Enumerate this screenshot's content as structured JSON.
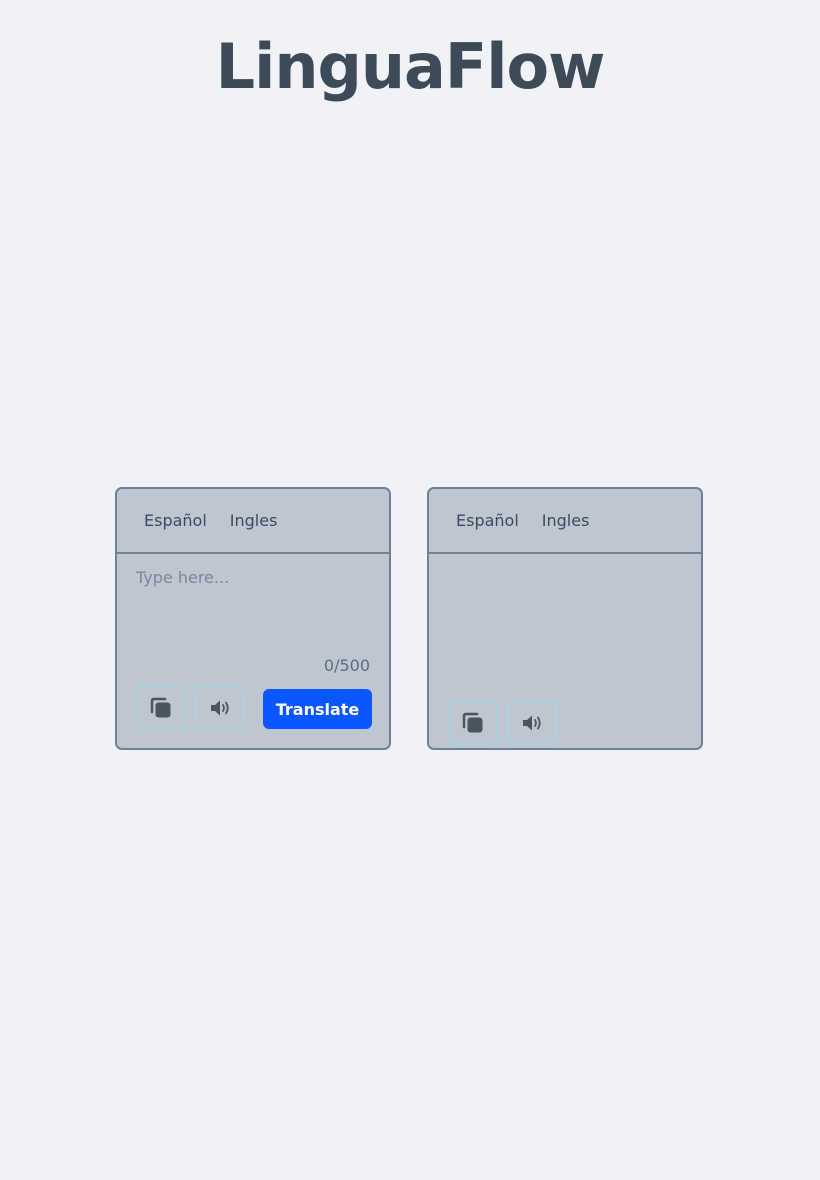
{
  "header": {
    "title": "LinguaFlow"
  },
  "source_panel": {
    "languages": [
      "Español",
      "Ingles"
    ],
    "input_placeholder": "Type here...",
    "input_value": "",
    "char_counter": "0/500",
    "translate_label": "Translate",
    "copy_icon": "copy-icon",
    "speak_icon": "speaker-icon"
  },
  "target_panel": {
    "languages": [
      "Español",
      "Ingles"
    ],
    "output_text": "",
    "copy_icon": "copy-icon",
    "speak_icon": "speaker-icon"
  },
  "colors": {
    "background": "#f0f2f5",
    "panel_bg": "#bec7d1",
    "panel_border": "#6f8194",
    "icon_border": "#a9d2dc",
    "accent": "#0a57ff",
    "title": "#3d4a58"
  }
}
